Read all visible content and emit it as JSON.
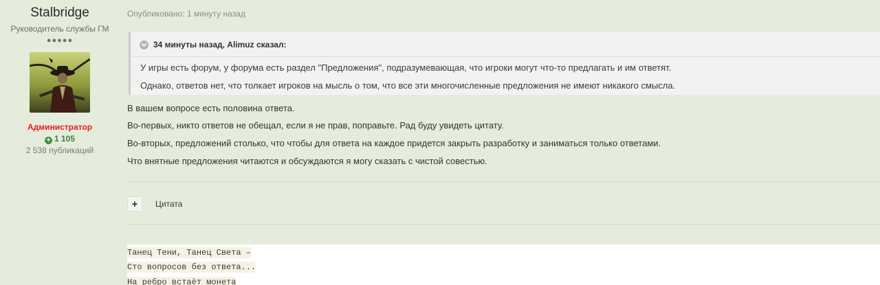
{
  "author": {
    "name": "Stalbridge",
    "title": "Руководитель службы ГМ",
    "rank_dots": "●●●●●",
    "group": "Администратор",
    "reputation": "1 105",
    "posts": "2 538 публикаций"
  },
  "post": {
    "meta": "Опубликовано: 1 минуту назад",
    "quote": {
      "header": "34 минуты назад, Alimuz сказал:",
      "lines": [
        "У игры есть форум, у форума есть раздел \"Предложения\", подразумевающая, что игроки могут что-то предлагать и им ответят.",
        "Однако, ответов нет, что толкает игроков на мысль о том, что все эти многочисленные предложения не имеют никакого смысла."
      ]
    },
    "body": [
      "В вашем вопросе есть половина ответа.",
      "Во-первых, никто ответов не обещал, если я не прав, поправьте. Рад буду увидеть цитату.",
      "Во-вторых, предложений столько, что чтобы для ответа на каждое придется закрыть разработку и заниматься только ответами.",
      "Что внятные предложения читаются и обсуждаются я могу сказать с чистой совестью."
    ],
    "quote_button": {
      "symbol": "+",
      "label": "Цитата"
    },
    "signature": [
      "Танец Тени, Танец Света –",
      "Сто вопросов без ответа...",
      "На ребро встаёт монета"
    ]
  }
}
